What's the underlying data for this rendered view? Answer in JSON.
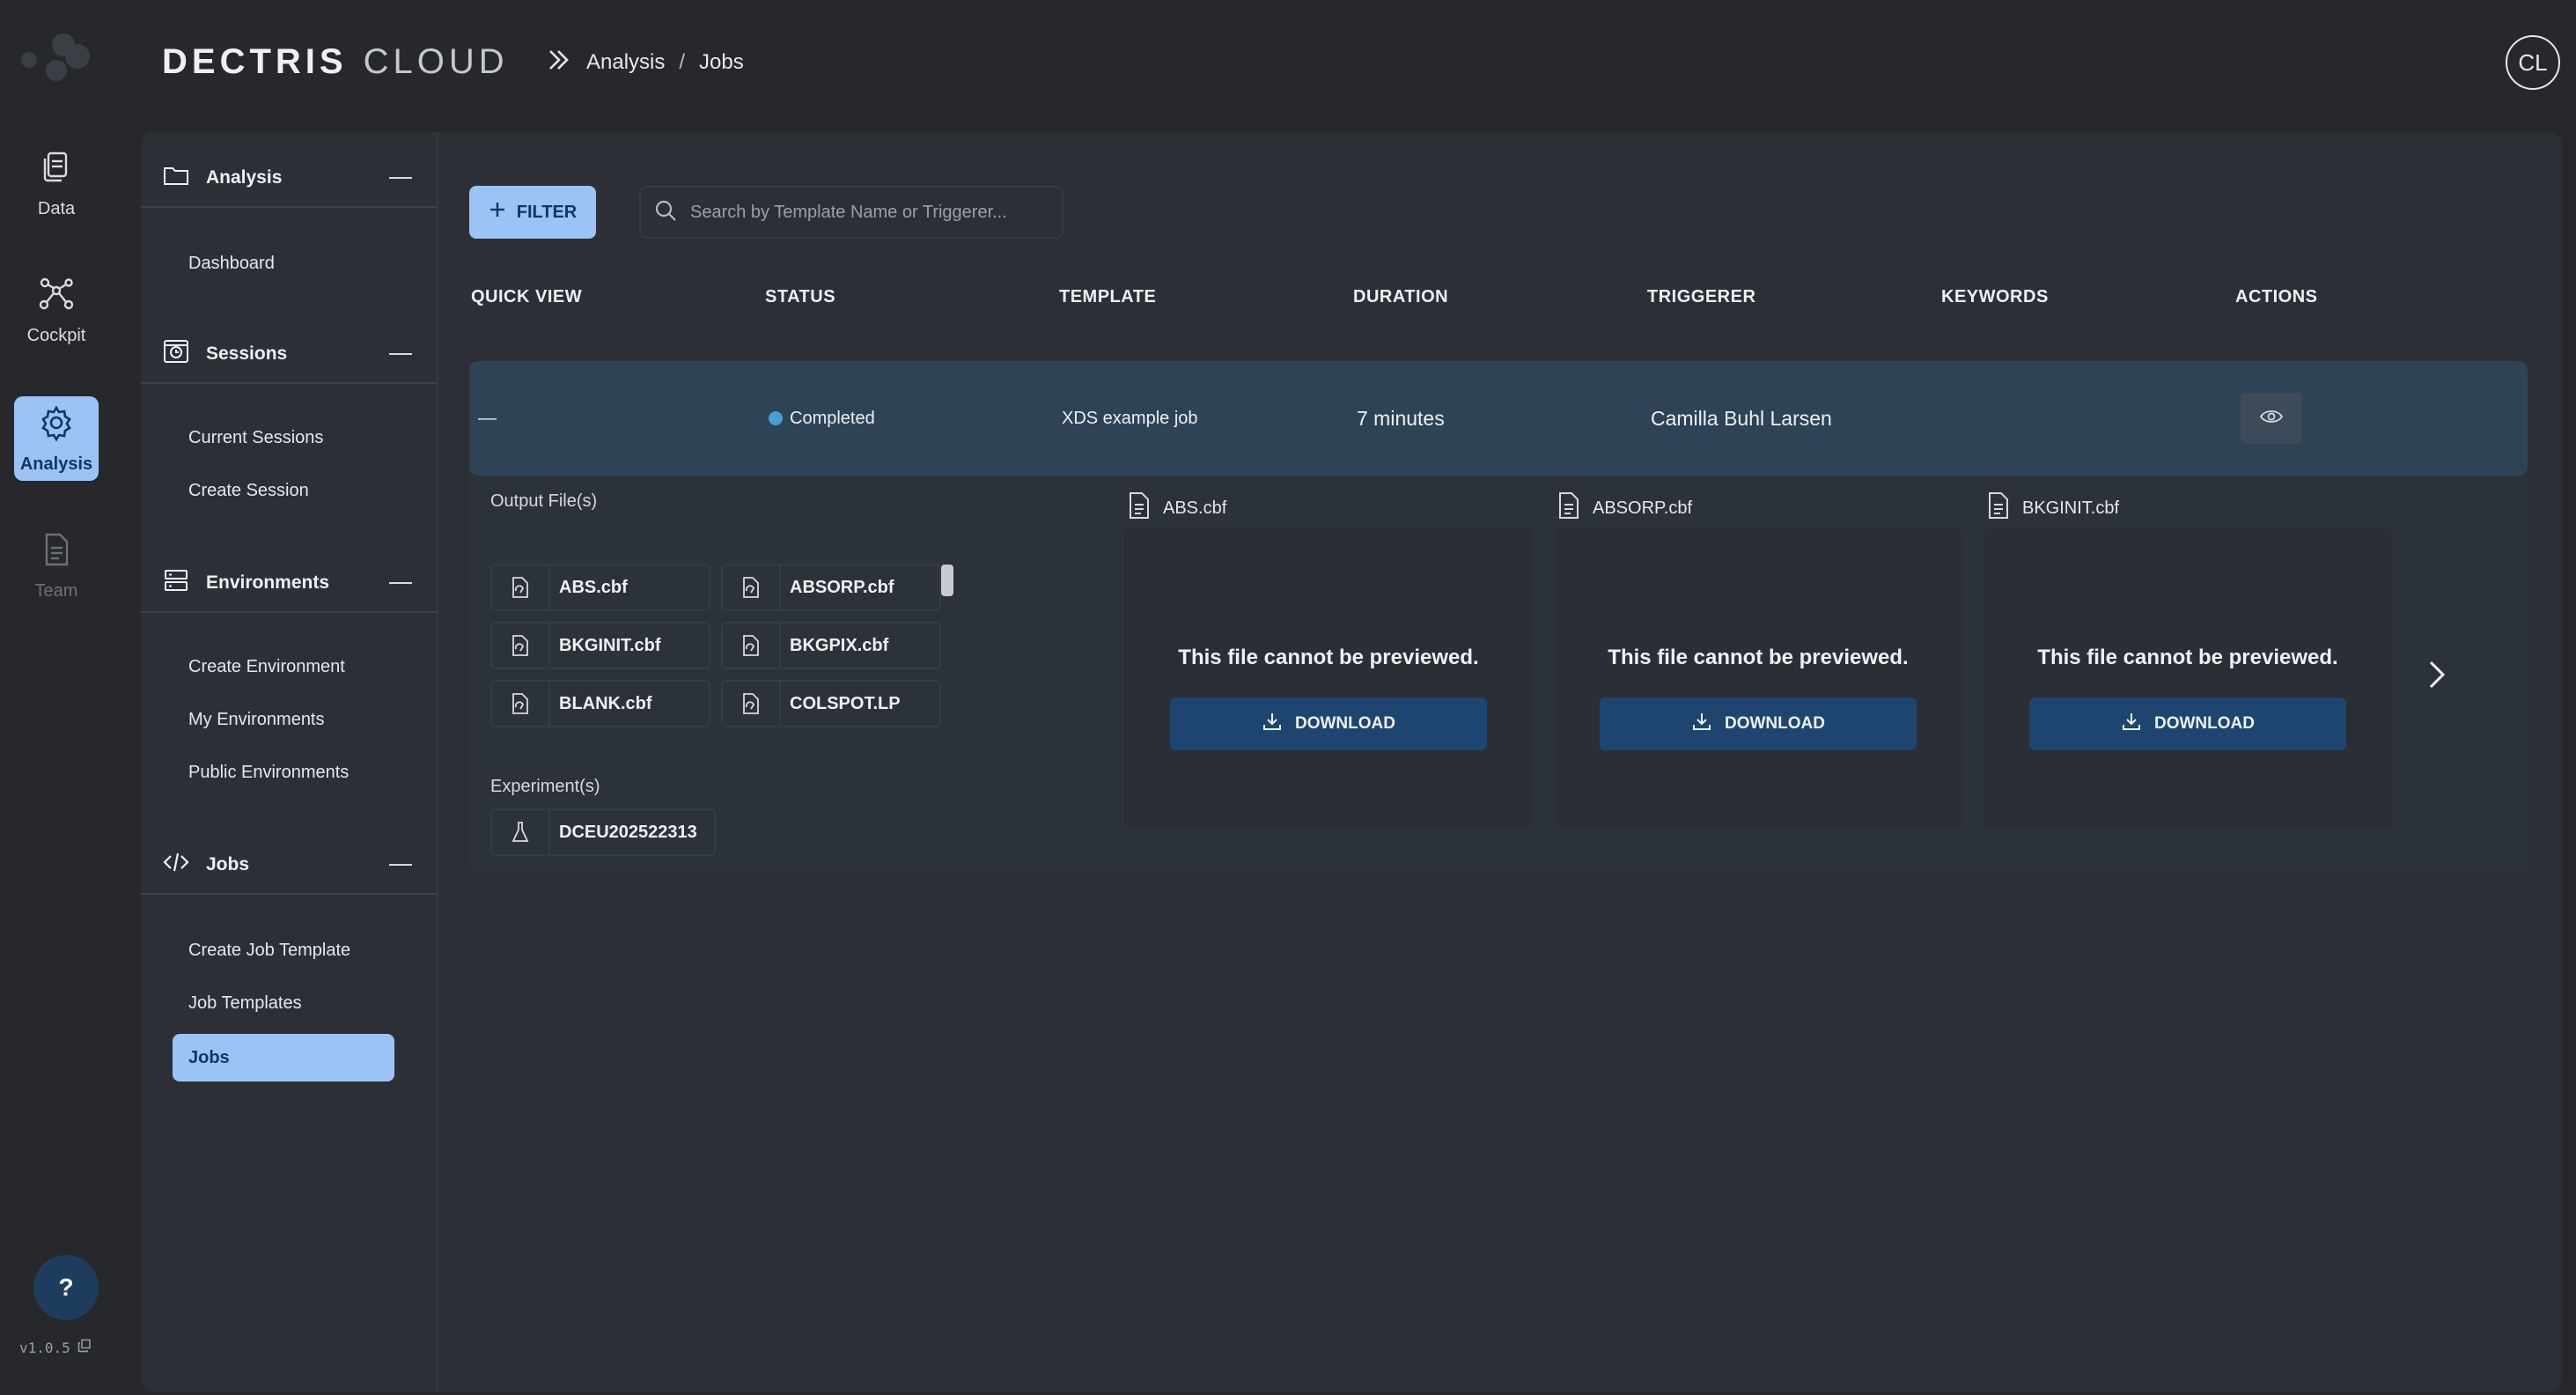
{
  "rail": {
    "items": [
      {
        "label": "Data",
        "icon": "data-icon"
      },
      {
        "label": "Cockpit",
        "icon": "network-icon"
      },
      {
        "label": "Analysis",
        "icon": "gear-icon",
        "active": true
      },
      {
        "label": "Team",
        "icon": "document-icon",
        "disabled": true
      }
    ],
    "help": "?",
    "version": "v1.0.5"
  },
  "header": {
    "brand_bold": "DECTRIS",
    "brand_light": "CLOUD",
    "breadcrumb": [
      "Analysis",
      "Jobs"
    ],
    "breadcrumb_sep": "/",
    "avatar_initials": "CL"
  },
  "subnav": {
    "sections": [
      {
        "title": "Analysis",
        "items": [
          "Dashboard"
        ]
      },
      {
        "title": "Sessions",
        "items": [
          "Current Sessions",
          "Create Session"
        ]
      },
      {
        "title": "Environments",
        "items": [
          "Create Environment",
          "My Environments",
          "Public Environments"
        ]
      },
      {
        "title": "Jobs",
        "items": [
          "Create Job Template",
          "Job Templates",
          "Jobs"
        ]
      }
    ],
    "active_item": "Jobs"
  },
  "toolbar": {
    "filter_label": "FILTER",
    "search_placeholder": "Search by Template Name or Triggerer..."
  },
  "table": {
    "columns": [
      "QUICK VIEW",
      "STATUS",
      "TEMPLATE",
      "DURATION",
      "TRIGGERER",
      "KEYWORDS",
      "ACTIONS"
    ],
    "row": {
      "quick_view": "—",
      "status": "Completed",
      "template": "XDS example job",
      "duration": "7 minutes",
      "triggerer": "Camilla Buhl Larsen",
      "keywords": ""
    }
  },
  "details": {
    "output_files_label": "Output File(s)",
    "output_files": [
      "ABS.cbf",
      "ABSORP.cbf",
      "BKGINIT.cbf",
      "BKGPIX.cbf",
      "BLANK.cbf",
      "COLSPOT.LP"
    ],
    "experiments_label": "Experiment(s)",
    "experiments": [
      "DCEU202522313"
    ],
    "previews": [
      {
        "name": "ABS.cbf",
        "message": "This file cannot be previewed.",
        "button": "DOWNLOAD"
      },
      {
        "name": "ABSORP.cbf",
        "message": "This file cannot be previewed.",
        "button": "DOWNLOAD"
      },
      {
        "name": "BKGINIT.cbf",
        "message": "This file cannot be previewed.",
        "button": "DOWNLOAD"
      }
    ]
  },
  "colors": {
    "accent": "#9cc3f5",
    "row_bg": "#2f4357",
    "download_bg": "#1e4570",
    "status_completed": "#4a9ed8"
  }
}
